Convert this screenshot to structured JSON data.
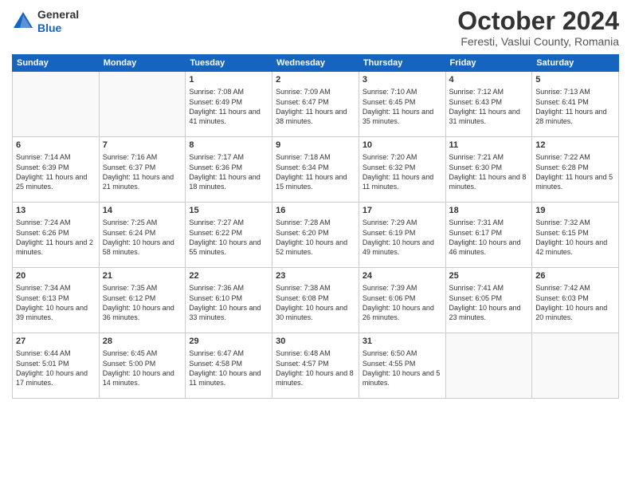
{
  "header": {
    "logo_line1": "General",
    "logo_line2": "Blue",
    "month_title": "October 2024",
    "location": "Feresti, Vaslui County, Romania"
  },
  "weekdays": [
    "Sunday",
    "Monday",
    "Tuesday",
    "Wednesday",
    "Thursday",
    "Friday",
    "Saturday"
  ],
  "weeks": [
    [
      {
        "day": "",
        "info": ""
      },
      {
        "day": "",
        "info": ""
      },
      {
        "day": "1",
        "info": "Sunrise: 7:08 AM\nSunset: 6:49 PM\nDaylight: 11 hours and 41 minutes."
      },
      {
        "day": "2",
        "info": "Sunrise: 7:09 AM\nSunset: 6:47 PM\nDaylight: 11 hours and 38 minutes."
      },
      {
        "day": "3",
        "info": "Sunrise: 7:10 AM\nSunset: 6:45 PM\nDaylight: 11 hours and 35 minutes."
      },
      {
        "day": "4",
        "info": "Sunrise: 7:12 AM\nSunset: 6:43 PM\nDaylight: 11 hours and 31 minutes."
      },
      {
        "day": "5",
        "info": "Sunrise: 7:13 AM\nSunset: 6:41 PM\nDaylight: 11 hours and 28 minutes."
      }
    ],
    [
      {
        "day": "6",
        "info": "Sunrise: 7:14 AM\nSunset: 6:39 PM\nDaylight: 11 hours and 25 minutes."
      },
      {
        "day": "7",
        "info": "Sunrise: 7:16 AM\nSunset: 6:37 PM\nDaylight: 11 hours and 21 minutes."
      },
      {
        "day": "8",
        "info": "Sunrise: 7:17 AM\nSunset: 6:36 PM\nDaylight: 11 hours and 18 minutes."
      },
      {
        "day": "9",
        "info": "Sunrise: 7:18 AM\nSunset: 6:34 PM\nDaylight: 11 hours and 15 minutes."
      },
      {
        "day": "10",
        "info": "Sunrise: 7:20 AM\nSunset: 6:32 PM\nDaylight: 11 hours and 11 minutes."
      },
      {
        "day": "11",
        "info": "Sunrise: 7:21 AM\nSunset: 6:30 PM\nDaylight: 11 hours and 8 minutes."
      },
      {
        "day": "12",
        "info": "Sunrise: 7:22 AM\nSunset: 6:28 PM\nDaylight: 11 hours and 5 minutes."
      }
    ],
    [
      {
        "day": "13",
        "info": "Sunrise: 7:24 AM\nSunset: 6:26 PM\nDaylight: 11 hours and 2 minutes."
      },
      {
        "day": "14",
        "info": "Sunrise: 7:25 AM\nSunset: 6:24 PM\nDaylight: 10 hours and 58 minutes."
      },
      {
        "day": "15",
        "info": "Sunrise: 7:27 AM\nSunset: 6:22 PM\nDaylight: 10 hours and 55 minutes."
      },
      {
        "day": "16",
        "info": "Sunrise: 7:28 AM\nSunset: 6:20 PM\nDaylight: 10 hours and 52 minutes."
      },
      {
        "day": "17",
        "info": "Sunrise: 7:29 AM\nSunset: 6:19 PM\nDaylight: 10 hours and 49 minutes."
      },
      {
        "day": "18",
        "info": "Sunrise: 7:31 AM\nSunset: 6:17 PM\nDaylight: 10 hours and 46 minutes."
      },
      {
        "day": "19",
        "info": "Sunrise: 7:32 AM\nSunset: 6:15 PM\nDaylight: 10 hours and 42 minutes."
      }
    ],
    [
      {
        "day": "20",
        "info": "Sunrise: 7:34 AM\nSunset: 6:13 PM\nDaylight: 10 hours and 39 minutes."
      },
      {
        "day": "21",
        "info": "Sunrise: 7:35 AM\nSunset: 6:12 PM\nDaylight: 10 hours and 36 minutes."
      },
      {
        "day": "22",
        "info": "Sunrise: 7:36 AM\nSunset: 6:10 PM\nDaylight: 10 hours and 33 minutes."
      },
      {
        "day": "23",
        "info": "Sunrise: 7:38 AM\nSunset: 6:08 PM\nDaylight: 10 hours and 30 minutes."
      },
      {
        "day": "24",
        "info": "Sunrise: 7:39 AM\nSunset: 6:06 PM\nDaylight: 10 hours and 26 minutes."
      },
      {
        "day": "25",
        "info": "Sunrise: 7:41 AM\nSunset: 6:05 PM\nDaylight: 10 hours and 23 minutes."
      },
      {
        "day": "26",
        "info": "Sunrise: 7:42 AM\nSunset: 6:03 PM\nDaylight: 10 hours and 20 minutes."
      }
    ],
    [
      {
        "day": "27",
        "info": "Sunrise: 6:44 AM\nSunset: 5:01 PM\nDaylight: 10 hours and 17 minutes."
      },
      {
        "day": "28",
        "info": "Sunrise: 6:45 AM\nSunset: 5:00 PM\nDaylight: 10 hours and 14 minutes."
      },
      {
        "day": "29",
        "info": "Sunrise: 6:47 AM\nSunset: 4:58 PM\nDaylight: 10 hours and 11 minutes."
      },
      {
        "day": "30",
        "info": "Sunrise: 6:48 AM\nSunset: 4:57 PM\nDaylight: 10 hours and 8 minutes."
      },
      {
        "day": "31",
        "info": "Sunrise: 6:50 AM\nSunset: 4:55 PM\nDaylight: 10 hours and 5 minutes."
      },
      {
        "day": "",
        "info": ""
      },
      {
        "day": "",
        "info": ""
      }
    ]
  ]
}
